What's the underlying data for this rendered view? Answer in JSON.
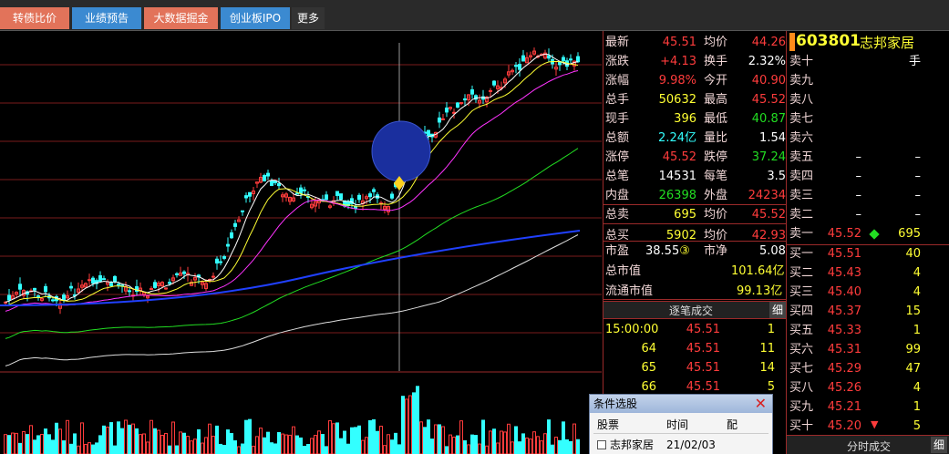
{
  "tabs": [
    {
      "label": "转债比价"
    },
    {
      "label": "业绩预告"
    },
    {
      "label": "大数据掘金"
    },
    {
      "label": "创业板IPO"
    },
    {
      "label": "更多"
    }
  ],
  "stock": {
    "code": "603801",
    "name": "志邦家居"
  },
  "quote_left": [
    {
      "label": "最新",
      "value": "45.51"
    },
    {
      "label": "涨跌",
      "value": "+4.13"
    },
    {
      "label": "涨幅",
      "value": "9.98%"
    },
    {
      "label": "总手",
      "value": "50632"
    },
    {
      "label": "现手",
      "value": "396"
    },
    {
      "label": "总额",
      "value": "2.24亿"
    },
    {
      "label": "涨停",
      "value": "45.52"
    },
    {
      "label": "总笔",
      "value": "14531"
    },
    {
      "label": "内盘",
      "value": "26398"
    },
    {
      "label": "总卖",
      "value": "695"
    },
    {
      "label": "总买",
      "value": "5902"
    }
  ],
  "quote_right": [
    {
      "label": "均价",
      "value": "44.26"
    },
    {
      "label": "换手",
      "value": "2.32%"
    },
    {
      "label": "今开",
      "value": "40.90"
    },
    {
      "label": "最高",
      "value": "45.52"
    },
    {
      "label": "最低",
      "value": "40.87"
    },
    {
      "label": "量比",
      "value": "1.54"
    },
    {
      "label": "跌停",
      "value": "37.24"
    },
    {
      "label": "每笔",
      "value": "3.5"
    },
    {
      "label": "外盘",
      "value": "24234"
    },
    {
      "label": "均价",
      "value": "45.52"
    },
    {
      "label": "均价",
      "value": "42.93"
    }
  ],
  "valuation": {
    "pe_label": "市盈",
    "pe_value": "38.55",
    "pe_badge": "③",
    "pb_label": "市净",
    "pb_value": "5.08",
    "mcap_label": "总市值",
    "mcap_value": "101.64亿",
    "float_label": "流通市值",
    "float_value": "99.13亿"
  },
  "trades": {
    "header": "逐笔成交",
    "detail_btn": "细",
    "rows": [
      {
        "time": "15:00:00",
        "price": "45.51",
        "vol": "1"
      },
      {
        "time": "64",
        "price": "45.51",
        "vol": "11"
      },
      {
        "time": "65",
        "price": "45.51",
        "vol": "14"
      },
      {
        "time": "66",
        "price": "45.51",
        "vol": "5"
      }
    ]
  },
  "asks": [
    {
      "label": "卖十",
      "price": "",
      "vol": "手"
    },
    {
      "label": "卖九",
      "price": "",
      "vol": ""
    },
    {
      "label": "卖八",
      "price": "",
      "vol": ""
    },
    {
      "label": "卖七",
      "price": "",
      "vol": ""
    },
    {
      "label": "卖六",
      "price": "",
      "vol": ""
    },
    {
      "label": "卖五",
      "price": "–",
      "vol": "–"
    },
    {
      "label": "卖四",
      "price": "–",
      "vol": "–"
    },
    {
      "label": "卖三",
      "price": "–",
      "vol": "–"
    },
    {
      "label": "卖二",
      "price": "–",
      "vol": "–"
    },
    {
      "label": "卖一",
      "price": "45.52",
      "vol": "695"
    }
  ],
  "bids": [
    {
      "label": "买一",
      "price": "45.51",
      "vol": "40"
    },
    {
      "label": "买二",
      "price": "45.43",
      "vol": "4"
    },
    {
      "label": "买三",
      "price": "45.40",
      "vol": "4"
    },
    {
      "label": "买四",
      "price": "45.37",
      "vol": "15"
    },
    {
      "label": "买五",
      "price": "45.33",
      "vol": "1"
    },
    {
      "label": "买六",
      "price": "45.31",
      "vol": "99"
    },
    {
      "label": "买七",
      "price": "45.29",
      "vol": "47"
    },
    {
      "label": "买八",
      "price": "45.26",
      "vol": "4"
    },
    {
      "label": "买九",
      "price": "45.21",
      "vol": "1"
    },
    {
      "label": "买十",
      "price": "45.20",
      "vol": "5"
    }
  ],
  "bottom": {
    "tick_label": "分时成交",
    "detail_btn": "细"
  },
  "popup": {
    "title": "条件选股",
    "close": "✕",
    "col1": "股票",
    "col2": "时间",
    "col3": "配",
    "row_name": "志邦家居",
    "row_time": "21/02/03"
  },
  "colors": {
    "up": "#ff3c3c",
    "down": "#22dd22",
    "grid": "#9b2a2a",
    "tab_orange": "#e2735a",
    "tab_blue": "#3b8ad1"
  }
}
